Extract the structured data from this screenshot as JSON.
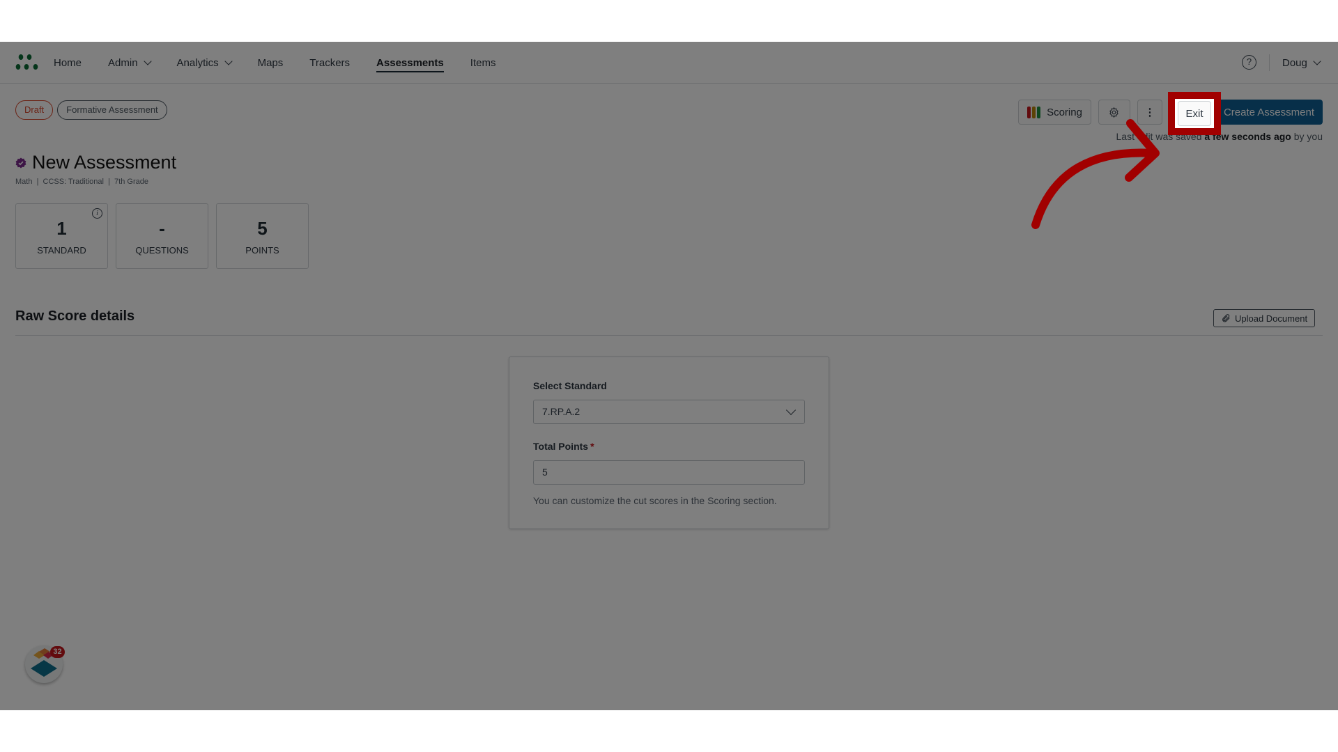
{
  "nav": {
    "items": [
      {
        "label": "Home"
      },
      {
        "label": "Admin",
        "dropdown": true
      },
      {
        "label": "Analytics",
        "dropdown": true
      },
      {
        "label": "Maps"
      },
      {
        "label": "Trackers"
      },
      {
        "label": "Assessments",
        "active": true
      },
      {
        "label": "Items"
      }
    ],
    "help_icon": "question-circle-icon",
    "user": "Doug"
  },
  "badges": {
    "status": "Draft",
    "type": "Formative Assessment"
  },
  "toolbar": {
    "scoring_label": "Scoring",
    "scoring_colors": [
      "#c4161c",
      "#b8860b",
      "#1e8f3e"
    ],
    "settings_icon": "gear-icon",
    "more_icon": "vertical-ellipsis-icon",
    "exit_label": "Exit",
    "create_label": "Create Assessment"
  },
  "saved": {
    "prefix": "Last edit was saved",
    "time": "a few seconds ago",
    "suffix": "by you"
  },
  "assessment": {
    "title": "New Assessment",
    "meta": "Math  |  CCSS: Traditional  |  7th Grade"
  },
  "stats": [
    {
      "value": "1",
      "label": "STANDARD",
      "info": true
    },
    {
      "value": "-",
      "label": "QUESTIONS"
    },
    {
      "value": "5",
      "label": "POINTS"
    }
  ],
  "section": {
    "title": "Raw Score details",
    "upload_label": "Upload Document"
  },
  "form": {
    "standard_label": "Select Standard",
    "standard_value": "7.RP.A.2",
    "points_label": "Total Points",
    "points_required": "*",
    "points_value": "5",
    "hint": "You can customize the cut scores in the Scoring section."
  },
  "widget": {
    "badge_count": "32"
  },
  "annotation": {
    "color": "#a10000",
    "target": "Exit"
  }
}
